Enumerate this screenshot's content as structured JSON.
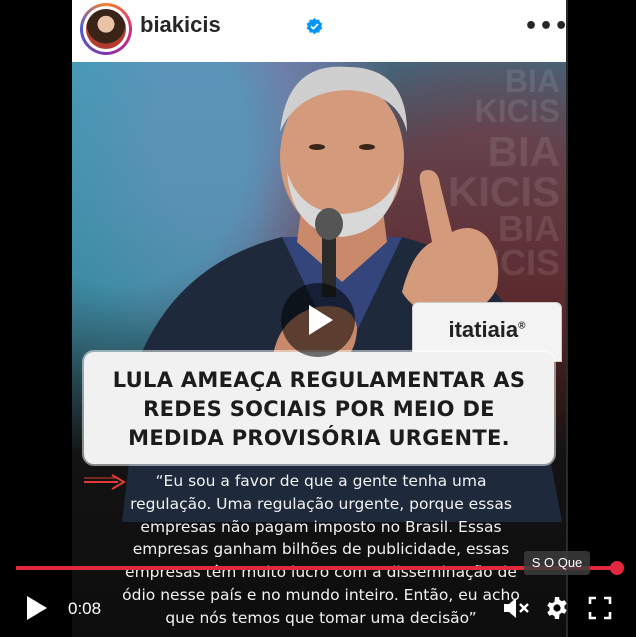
{
  "post": {
    "username": "biakicis",
    "verified_icon": "verified-badge-icon",
    "more_icon": "more-options-icon",
    "watermark_lines": [
      "BIA",
      "KICIS",
      "BIA",
      "KICIS",
      "BIA",
      "KICIS"
    ],
    "brand": "itatiaia",
    "brand_mark": "®",
    "headline_lines": [
      "LULA AMEAÇA REGULAMENTAR AS",
      "REDES SOCIAIS POR MEIO DE",
      "MEDIDA PROVISÓRIA URGENTE."
    ],
    "quote_lines": [
      "“Eu sou a favor de que a gente tenha uma",
      "regulação. Uma regulação urgente, porque essas",
      "empresas não pagam imposto no Brasil. Essas",
      "empresas ganham bilhões de publicidade, essas",
      "empresas têm muito lucro com a disseminação de",
      "ódio nesse país e no mundo inteiro. Então, eu acho",
      "que nós temos que tomar uma decisão”"
    ]
  },
  "player": {
    "time": "0:08",
    "tooltip": "S O Que",
    "progress": 0.995,
    "icons": [
      "play-icon",
      "mute-icon",
      "settings-gear-icon",
      "fullscreen-icon"
    ]
  },
  "colors": {
    "accent": "#e2283c",
    "verified": "#0095f6"
  }
}
